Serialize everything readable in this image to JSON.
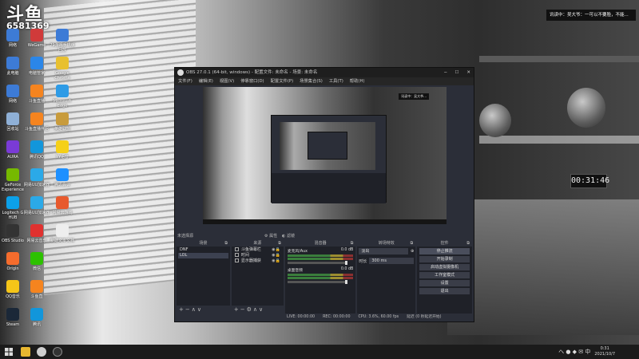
{
  "watermark": {
    "logo": "斗鱼",
    "room_id": "6581369"
  },
  "notification": {
    "text": "讯读中：吴大爷：一可以不要脸，不能..."
  },
  "desktop_icons": [
    {
      "label": "网络",
      "color": "#3d7bd6"
    },
    {
      "label": "此电脑",
      "color": "#3d7bd6"
    },
    {
      "label": "网络",
      "color": "#3d7bd6"
    },
    {
      "label": "回收站",
      "color": "#8fb0d6"
    },
    {
      "label": "AURA",
      "color": "#7a3bd6"
    },
    {
      "label": "GeForce Experience",
      "color": "#76b900"
    },
    {
      "label": "Logitech G HUB",
      "color": "#0ca0e8"
    },
    {
      "label": "OBS Studio",
      "color": "#333333"
    },
    {
      "label": "Origin",
      "color": "#f56c2d"
    },
    {
      "label": "QQ音乐",
      "color": "#f5c518"
    },
    {
      "label": "Steam",
      "color": "#1b2838"
    },
    {
      "label": "WeGame",
      "color": "#d03a3a"
    },
    {
      "label": "电脑管家",
      "color": "#2b86e8"
    },
    {
      "label": "斗鱼直播",
      "color": "#f5841f"
    },
    {
      "label": "斗鱼直播伴侣",
      "color": "#f5841f"
    },
    {
      "label": "腾讯QQ",
      "color": "#1296db"
    },
    {
      "label": "网易UU加速器",
      "color": "#2ba9e8"
    },
    {
      "label": "网易UU加速器",
      "color": "#2ba9e8"
    },
    {
      "label": "网易云音乐",
      "color": "#e0312f"
    },
    {
      "label": "微信",
      "color": "#2dc100"
    },
    {
      "label": "斗鱼直",
      "color": "#f5841f"
    },
    {
      "label": "腾讯",
      "color": "#1296db"
    },
    {
      "label": "79游戏手机版回放",
      "color": "#3d7bd6"
    },
    {
      "label": "Google Chrome",
      "color": "#e8c030"
    },
    {
      "label": "Microsoft Edge",
      "color": "#2e9be6"
    },
    {
      "label": "英雄联盟",
      "color": "#c89b3c"
    },
    {
      "label": "YY语音",
      "color": "#f5d018"
    },
    {
      "label": "腾讯会议",
      "color": "#1e90ff"
    },
    {
      "label": "网易云游戏",
      "color": "#e85a2d"
    },
    {
      "label": "新建文本文档",
      "color": "#eeeeee"
    }
  ],
  "desk_clock": "00:31:46",
  "obs": {
    "title": "OBS 27.0.1 (64-bit, windows) - 配置文件: 未命名 - 场景: 未命名",
    "menu": [
      "文件(F)",
      "编辑(E)",
      "视图(V)",
      "停靠窗口(D)",
      "配置文件(P)",
      "场景集合(S)",
      "工具(T)",
      "帮助(H)"
    ],
    "preview_overlay": "讯读中：吴大爷...",
    "no_source": "未选择源",
    "props_label": "属性",
    "filters_label": "滤镜",
    "docks": {
      "scenes": {
        "title": "场景",
        "items": [
          "DNF",
          "LOL"
        ],
        "selected": 1
      },
      "sources": {
        "title": "来源",
        "items": [
          "斗鱼弹幕栏",
          "时间",
          "显示器捕获"
        ]
      },
      "mixer": {
        "title": "混音器",
        "channels": [
          {
            "name": "麦克风/Aux",
            "db": "0.0 dB"
          },
          {
            "name": "桌面音频",
            "db": "0.0 dB"
          }
        ]
      },
      "transitions": {
        "title": "转场特效",
        "type": "淡出",
        "duration_label": "时长",
        "duration": "300 ms"
      },
      "controls": {
        "title": "控件",
        "buttons": [
          "停止推流",
          "开始录制",
          "启动虚拟摄像机",
          "工作室模式",
          "设置",
          "退出"
        ]
      }
    },
    "status": {
      "live": "LIVE: 00:00:00",
      "rec": "REC: 00:00:00",
      "cpu": "CPU: 3.6%, 60.00 fps",
      "quality": "延迟 (0 秒延迟开始)"
    }
  },
  "taskbar": {
    "time": "0:31",
    "date": "2021/10/7",
    "tray": "ヘ ● ◆ ✉ 中"
  }
}
